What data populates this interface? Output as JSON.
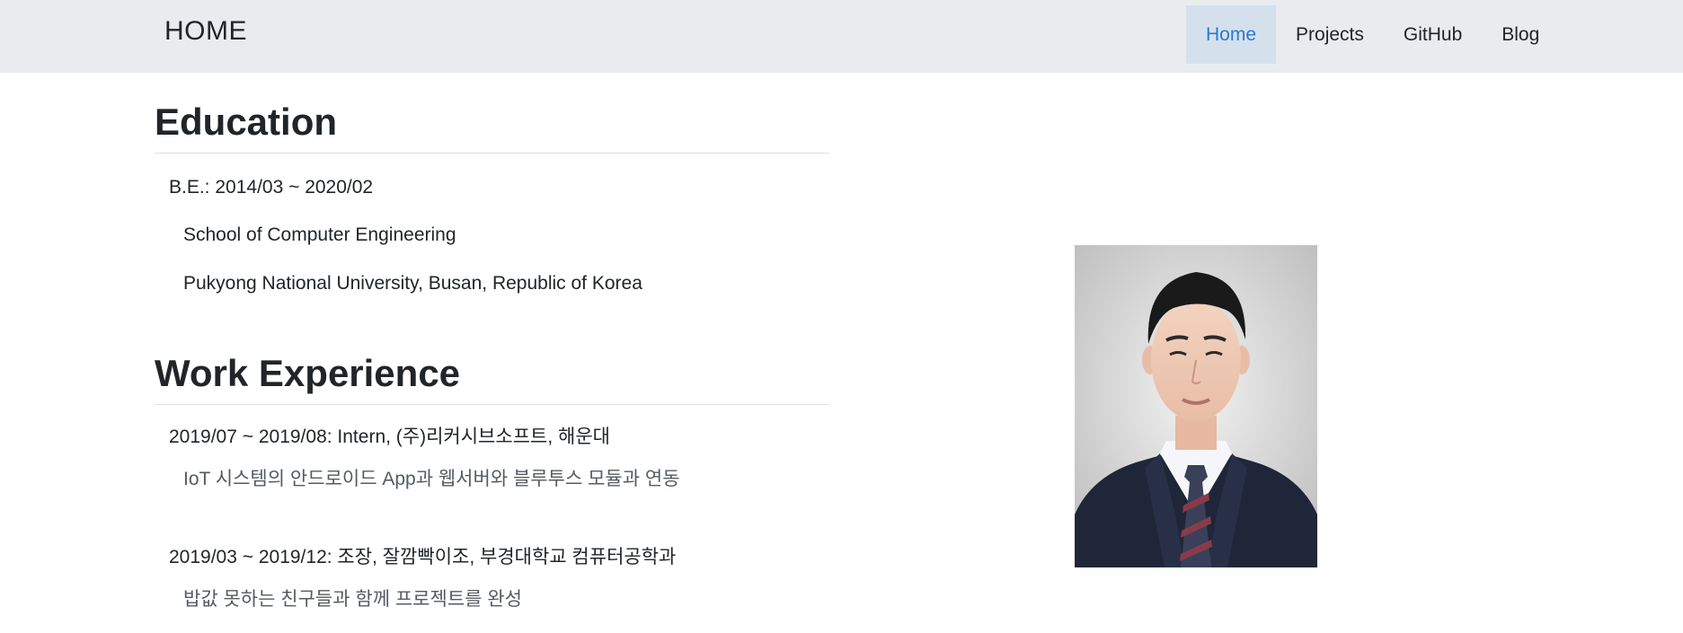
{
  "nav": {
    "brand": "HOME",
    "items": [
      {
        "label": "Home",
        "active": true
      },
      {
        "label": "Projects",
        "active": false
      },
      {
        "label": "GitHub",
        "active": false
      },
      {
        "label": "Blog",
        "active": false
      }
    ]
  },
  "education": {
    "title": "Education",
    "degree": "B.E.: 2014/03 ~ 2020/02",
    "school": "School of Computer Engineering",
    "university": "Pukyong National University, Busan, Republic of Korea"
  },
  "work": {
    "title": "Work Experience",
    "entries": [
      {
        "heading": "2019/07 ~ 2019/08: Intern, (주)리커시브소프트, 해운대",
        "detail": "IoT 시스템의 안드로이드 App과 웹서버와 블루투스 모듈과 연동"
      },
      {
        "heading": "2019/03 ~ 2019/12: 조장, 잘깜빡이조, 부경대학교 컴퓨터공학과",
        "detail": "밥값 못하는 친구들과 함께 프로젝트를 완성"
      }
    ]
  },
  "colors": {
    "navbar_bg": "#e9ecef",
    "active_bg": "#d4e0ec",
    "active_text": "#2a7ad2"
  }
}
